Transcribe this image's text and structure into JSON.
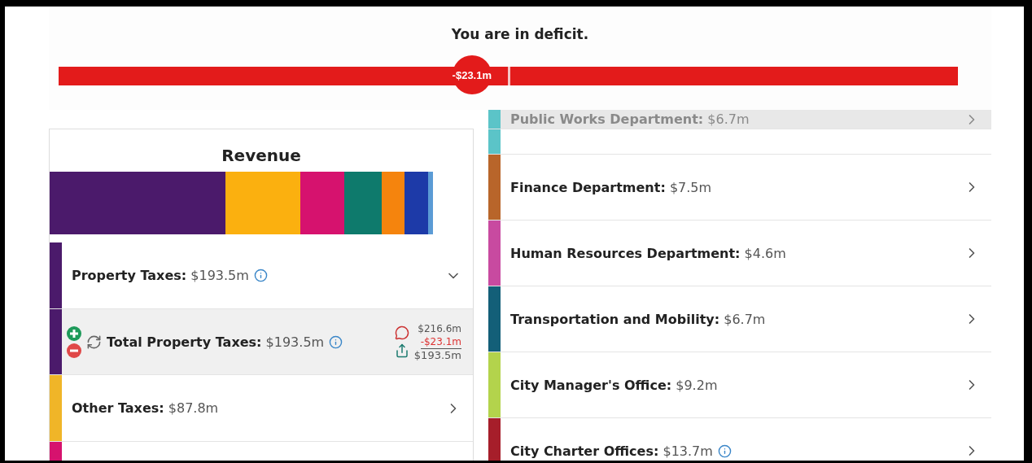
{
  "deficit": {
    "title": "You are in deficit.",
    "amount": "-$23.1m",
    "level": 0.46
  },
  "revenue": {
    "title": "Revenue",
    "items": [
      {
        "label": "Property Taxes:",
        "amount": "$193.5m",
        "color": "#4b1a6b",
        "info": true,
        "expanded": true,
        "children": [
          {
            "label": "Total Property Taxes:",
            "amount": "$193.5m",
            "info": true,
            "original": "$216.6m",
            "change": "-$23.1m",
            "result": "$193.5m"
          }
        ]
      },
      {
        "label": "Other Taxes:",
        "amount": "$87.8m",
        "color": "#f0b528",
        "info": false,
        "expanded": false
      },
      {
        "color": "#d6126e"
      }
    ]
  },
  "expenses": {
    "items": [
      {
        "label": "Public Works Department:",
        "amount": "$6.7m",
        "color": "#5bc4c8",
        "faded": true
      },
      {
        "color": "#5bc4c8",
        "faded": false
      },
      {
        "label": "Finance Department:",
        "amount": "$7.5m",
        "color": "#b8652a",
        "faded": false
      },
      {
        "label": "Human Resources Department:",
        "amount": "$4.6m",
        "color": "#c84aa0",
        "faded": false
      },
      {
        "label": "Transportation and Mobility:",
        "amount": "$6.7m",
        "color": "#135f78",
        "faded": false
      },
      {
        "label": "City Manager's Office:",
        "amount": "$9.2m",
        "color": "#b3d34c",
        "faded": false
      },
      {
        "label": "City Charter Offices:",
        "amount": "$13.7m",
        "color": "#a61e2a",
        "info": true,
        "faded": false
      }
    ]
  }
}
